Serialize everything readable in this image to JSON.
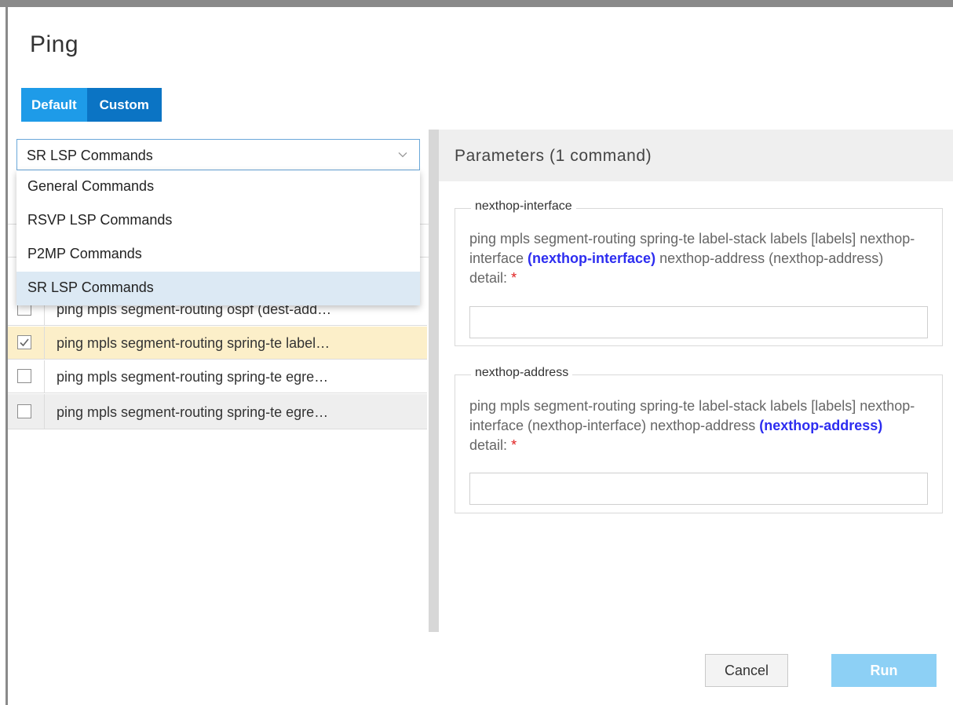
{
  "dialog": {
    "title": "Ping"
  },
  "mode_toggle": {
    "default_label": "Default",
    "custom_label": "Custom",
    "selected": "Custom"
  },
  "command_type": {
    "selected": "SR LSP Commands",
    "options": [
      "General Commands",
      "RSVP LSP Commands",
      "P2MP Commands",
      "SR LSP Commands"
    ]
  },
  "commands": [
    {
      "text": "ping mpls segment-routing ospf (dest-add…",
      "checked": false
    },
    {
      "text": "ping mpls segment-routing spring-te label…",
      "checked": true
    },
    {
      "text": "ping mpls segment-routing spring-te egre…",
      "checked": false
    },
    {
      "text": "ping mpls segment-routing spring-te egre…",
      "checked": false
    }
  ],
  "parameters": {
    "header": "Parameters (1 command)",
    "fields": [
      {
        "legend": "nexthop-interface",
        "desc_before": "ping mpls segment-routing spring-te label-stack labels [labels] nexthop-interface ",
        "desc_highlight": "(nexthop-interface)",
        "desc_after": " nexthop-address (nexthop-address) detail:",
        "required_mark": "*",
        "value": ""
      },
      {
        "legend": "nexthop-address",
        "desc_before": "ping mpls segment-routing spring-te label-stack labels [labels] nexthop-interface (nexthop-interface) nexthop-address ",
        "desc_highlight": "(nexthop-address)",
        "desc_after": " detail:",
        "required_mark": "*",
        "value": ""
      }
    ]
  },
  "footer": {
    "cancel_label": "Cancel",
    "run_label": "Run"
  },
  "colors": {
    "accent": "#1e9be8",
    "toggle_selected": "#0b74c4",
    "highlight": "#2d2df0",
    "required": "#e02020",
    "run_disabled": "#8dd0f5",
    "row_selected": "#fcefc9"
  }
}
